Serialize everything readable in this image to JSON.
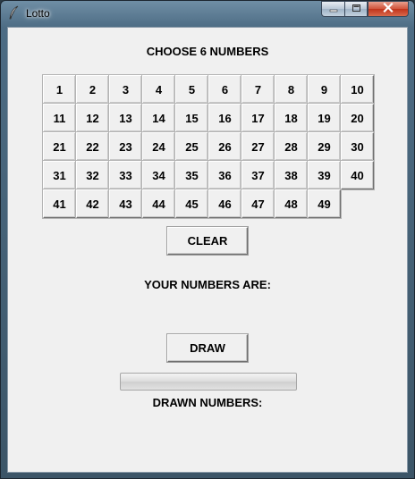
{
  "window": {
    "title": "Lotto",
    "app_icon": "feather-icon",
    "controls": [
      "minimize-icon",
      "maximize-icon",
      "close-icon"
    ]
  },
  "choose_label": "CHOOSE 6 NUMBERS",
  "numbers": [
    "1",
    "2",
    "3",
    "4",
    "5",
    "6",
    "7",
    "8",
    "9",
    "10",
    "11",
    "12",
    "13",
    "14",
    "15",
    "16",
    "17",
    "18",
    "19",
    "20",
    "21",
    "22",
    "23",
    "24",
    "25",
    "26",
    "27",
    "28",
    "29",
    "30",
    "31",
    "32",
    "33",
    "34",
    "35",
    "36",
    "37",
    "38",
    "39",
    "40",
    "41",
    "42",
    "43",
    "44",
    "45",
    "46",
    "47",
    "48",
    "49"
  ],
  "clear_label": "CLEAR",
  "your_numbers_label": "YOUR NUMBERS ARE:",
  "draw_label": "DRAW",
  "progress": 0,
  "drawn_numbers_label": "DRAWN NUMBERS:",
  "colors": {
    "close_button": "#c1341b",
    "client_bg": "#f0f0f0"
  }
}
